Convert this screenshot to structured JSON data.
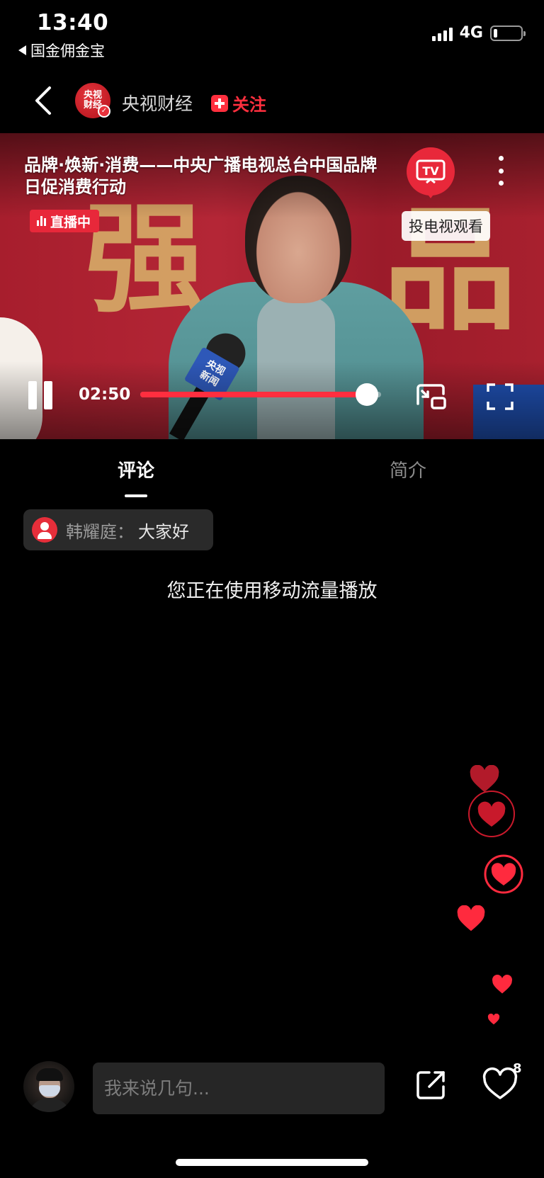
{
  "status_bar": {
    "time": "13:40",
    "back_app": "国金佣金宝",
    "network": "4G"
  },
  "header": {
    "channel_name": "央视财经",
    "logo_text": [
      "央视",
      "财经"
    ],
    "follow_label": "关注",
    "icons": [
      "back-chevron-icon",
      "verified-badge-icon",
      "plus-icon"
    ]
  },
  "video": {
    "title": "品牌·焕新·消费——中央广播电视总台中国品牌日促消费行动",
    "live_label": "直播中",
    "cast_label": "投电视观看",
    "cast_icon_text": "TV",
    "mic_flag": [
      "央视",
      "新闻"
    ],
    "background_text": [
      "强",
      "品"
    ],
    "current_time": "02:50",
    "progress": 0.94,
    "accent_color": "#ff2e3f"
  },
  "tabs": {
    "comments": "评论",
    "intro": "简介",
    "active": "comments"
  },
  "comment": {
    "user": "韩耀庭：",
    "text": "大家好"
  },
  "notice": "您正在使用移动流量播放",
  "bottom_bar": {
    "input_placeholder": "我来说几句...",
    "like_count": "8",
    "icons": [
      "share-icon",
      "heart-icon"
    ]
  }
}
